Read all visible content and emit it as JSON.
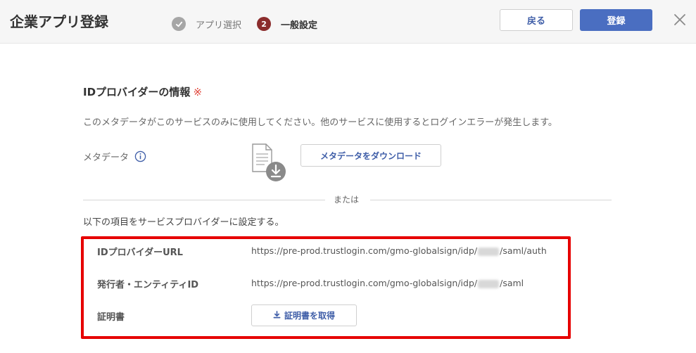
{
  "header": {
    "title": "企業アプリ登録",
    "steps": [
      {
        "number": "✓",
        "label": "アプリ選択",
        "state": "done"
      },
      {
        "number": "2",
        "label": "一般設定",
        "state": "active"
      }
    ],
    "back_label": "戻る",
    "register_label": "登録"
  },
  "section": {
    "title": "IDプロバイダーの情報",
    "required_mark": "※",
    "description": "このメタデータがこのサービスのみに使用してください。他のサービスに使用するとログインエラーが発生します。"
  },
  "metadata": {
    "label": "メタデータ",
    "download_label": "メタデータをダウンロード"
  },
  "divider_text": "または",
  "sub_description": "以下の項目をサービスプロバイダーに設定する。",
  "fields": {
    "idp_url": {
      "label": "IDプロバイダーURL",
      "value_prefix": "https://pre-prod.trustlogin.com/gmo-globalsign/idp/",
      "value_suffix": "/saml/auth"
    },
    "entity_id": {
      "label": "発行者・エンティティID",
      "value_prefix": "https://pre-prod.trustlogin.com/gmo-globalsign/idp/",
      "value_suffix": "/saml"
    },
    "certificate": {
      "label": "証明書",
      "button_label": "証明書を取得"
    }
  },
  "colors": {
    "accent": "#4a6ec1",
    "link": "#3f5ea8",
    "step_active": "#8b2c2c",
    "highlight": "#e60000"
  }
}
